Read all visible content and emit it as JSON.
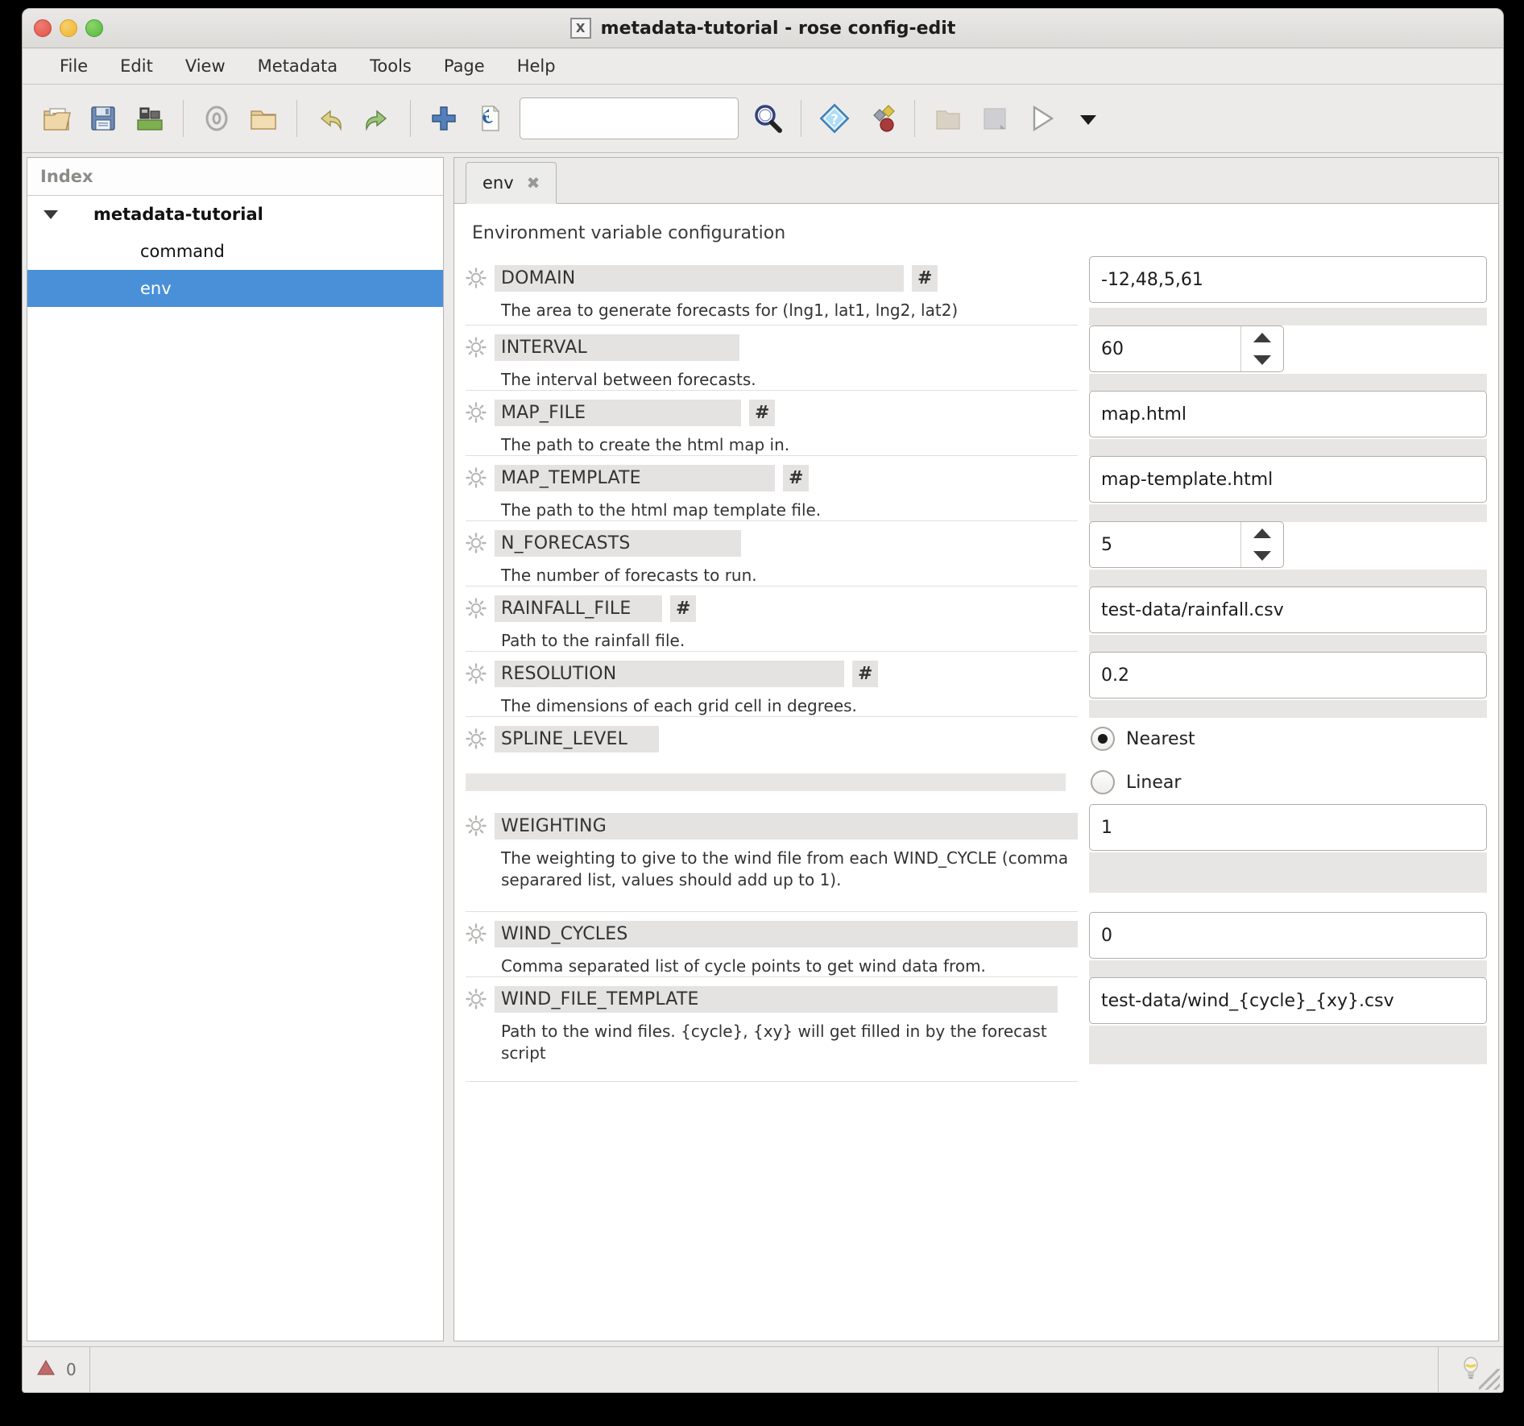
{
  "window": {
    "title": "metadata-tutorial - rose config-edit",
    "app_icon": "x-window-icon"
  },
  "menubar": {
    "items": [
      "File",
      "Edit",
      "View",
      "Metadata",
      "Tools",
      "Page",
      "Help"
    ]
  },
  "toolbar": {
    "search_value": "",
    "search_placeholder": "",
    "buttons": [
      {
        "name": "new-config-icon",
        "title": "New"
      },
      {
        "name": "save-icon",
        "title": "Save"
      },
      {
        "name": "save-all-icon",
        "title": "Save All"
      },
      {
        "name": "check-all-icon",
        "title": "Check All"
      },
      {
        "name": "open-folder-icon",
        "title": "Browse"
      },
      {
        "name": "undo-icon",
        "title": "Undo"
      },
      {
        "name": "redo-icon",
        "title": "Redo"
      },
      {
        "name": "add-icon",
        "title": "Add"
      },
      {
        "name": "revert-icon",
        "title": "Revert"
      },
      {
        "name": "find-icon",
        "title": "Find"
      },
      {
        "name": "help-icon",
        "title": "Help"
      },
      {
        "name": "metadata-icon",
        "title": "Metadata"
      },
      {
        "name": "view-latent-icon",
        "title": "View Latent"
      },
      {
        "name": "view-fixed-icon",
        "title": "View Fixed"
      },
      {
        "name": "run-suite-icon",
        "title": "Run Suite"
      },
      {
        "name": "run-menu-arrow-icon",
        "title": "Run options"
      }
    ]
  },
  "sidebar": {
    "header": "Index",
    "tree": [
      {
        "label": "metadata-tutorial",
        "level": 0,
        "selected": false,
        "expanded": true
      },
      {
        "label": "command",
        "level": 1,
        "selected": false
      },
      {
        "label": "env",
        "level": 1,
        "selected": true
      }
    ]
  },
  "main": {
    "tabs": [
      {
        "label": "env",
        "close": "✖",
        "active": true
      }
    ],
    "pane_title": "Environment variable configuration"
  },
  "variables": [
    {
      "name": "DOMAIN",
      "hash": "#",
      "description": "The area to generate forecasts for (lng1, lat1, lng2, lat2)",
      "widget": "text",
      "value": "-12,48,5,61"
    },
    {
      "name": "INTERVAL",
      "hash": "",
      "description": "The interval between forecasts.",
      "widget": "spin",
      "value": "60"
    },
    {
      "name": "MAP_FILE",
      "hash": "#",
      "description": "The path to create the html map in.",
      "widget": "text",
      "value": "map.html"
    },
    {
      "name": "MAP_TEMPLATE",
      "hash": "#",
      "description": "The path to the html map template file.",
      "widget": "text",
      "value": "map-template.html"
    },
    {
      "name": "N_FORECASTS",
      "hash": "",
      "description": "The number of forecasts to run.",
      "widget": "spin",
      "value": "5"
    },
    {
      "name": "RAINFALL_FILE",
      "hash": "#",
      "description": "Path to the rainfall file.",
      "widget": "text",
      "value": "test-data/rainfall.csv"
    },
    {
      "name": "RESOLUTION",
      "hash": "#",
      "description": "The dimensions of each grid cell in degrees.",
      "widget": "text",
      "value": "0.2"
    },
    {
      "name": "SPLINE_LEVEL",
      "hash": "",
      "description": "",
      "widget": "radio",
      "options": [
        "Nearest",
        "Linear"
      ],
      "value": "Nearest"
    },
    {
      "name": "WEIGHTING",
      "hash": "",
      "description": "The weighting to give to the wind file from each WIND_CYCLE (comma separared list, values should add up to 1).",
      "widget": "text",
      "value": "1"
    },
    {
      "name": "WIND_CYCLES",
      "hash": "",
      "description": "Comma separated list of cycle points to get wind data from.",
      "widget": "text",
      "value": "0"
    },
    {
      "name": "WIND_FILE_TEMPLATE",
      "hash": "",
      "description": "Path to the wind files. {cycle}, {xy} will get filled in by the forecast script",
      "widget": "text",
      "value": "test-data/wind_{cycle}_{xy}.csv"
    }
  ],
  "statusbar": {
    "error_count": "0",
    "error_icon": "warning-triangle-icon",
    "hint_icon": "lightbulb-icon"
  },
  "colors": {
    "selection": "#4a90d9",
    "window_bg": "#ecebe9",
    "field_bg": "#ffffff",
    "label_bg": "#e4e3e1"
  }
}
